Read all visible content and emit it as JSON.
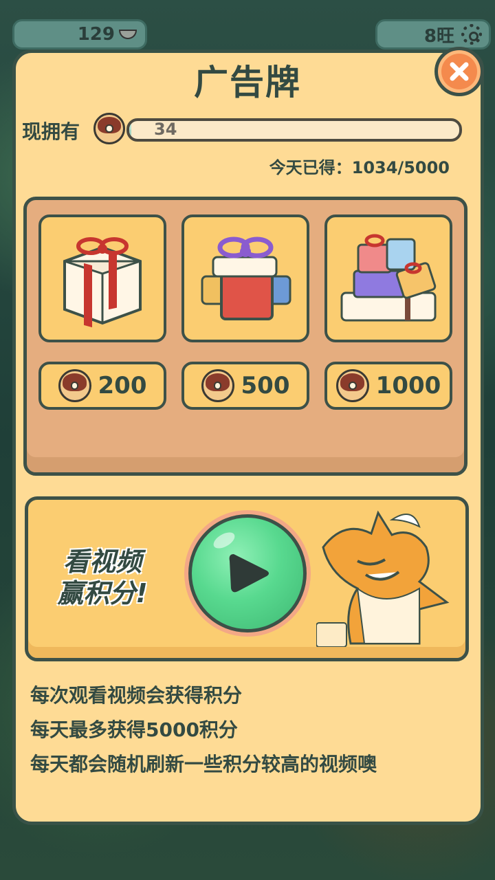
{
  "hud": {
    "coins": "129",
    "wang": "8旺"
  },
  "panel": {
    "title": "广告牌",
    "own_label": "现拥有",
    "owned_points": "34",
    "owned_progress": 0.0068,
    "today_label": "今天已得：1034/5000"
  },
  "shop": {
    "items": [
      {
        "icon": "gift-box-icon",
        "price": "200"
      },
      {
        "icon": "gift-stack-icon",
        "price": "500"
      },
      {
        "icon": "gift-pile-icon",
        "price": "1000"
      }
    ]
  },
  "video": {
    "line1": "看视频",
    "line2": "赢积分!"
  },
  "info": [
    "每次观看视频会获得积分",
    "每天最多获得5000积分",
    "每天都会随机刷新一些积分较高的视频噢"
  ],
  "colors": {
    "panel": "#fedb95",
    "card": "#fbcd71",
    "shop_bg": "#e5ad7f",
    "border": "#3d5148",
    "play": "#58d98f",
    "close": "#f48a4d"
  }
}
